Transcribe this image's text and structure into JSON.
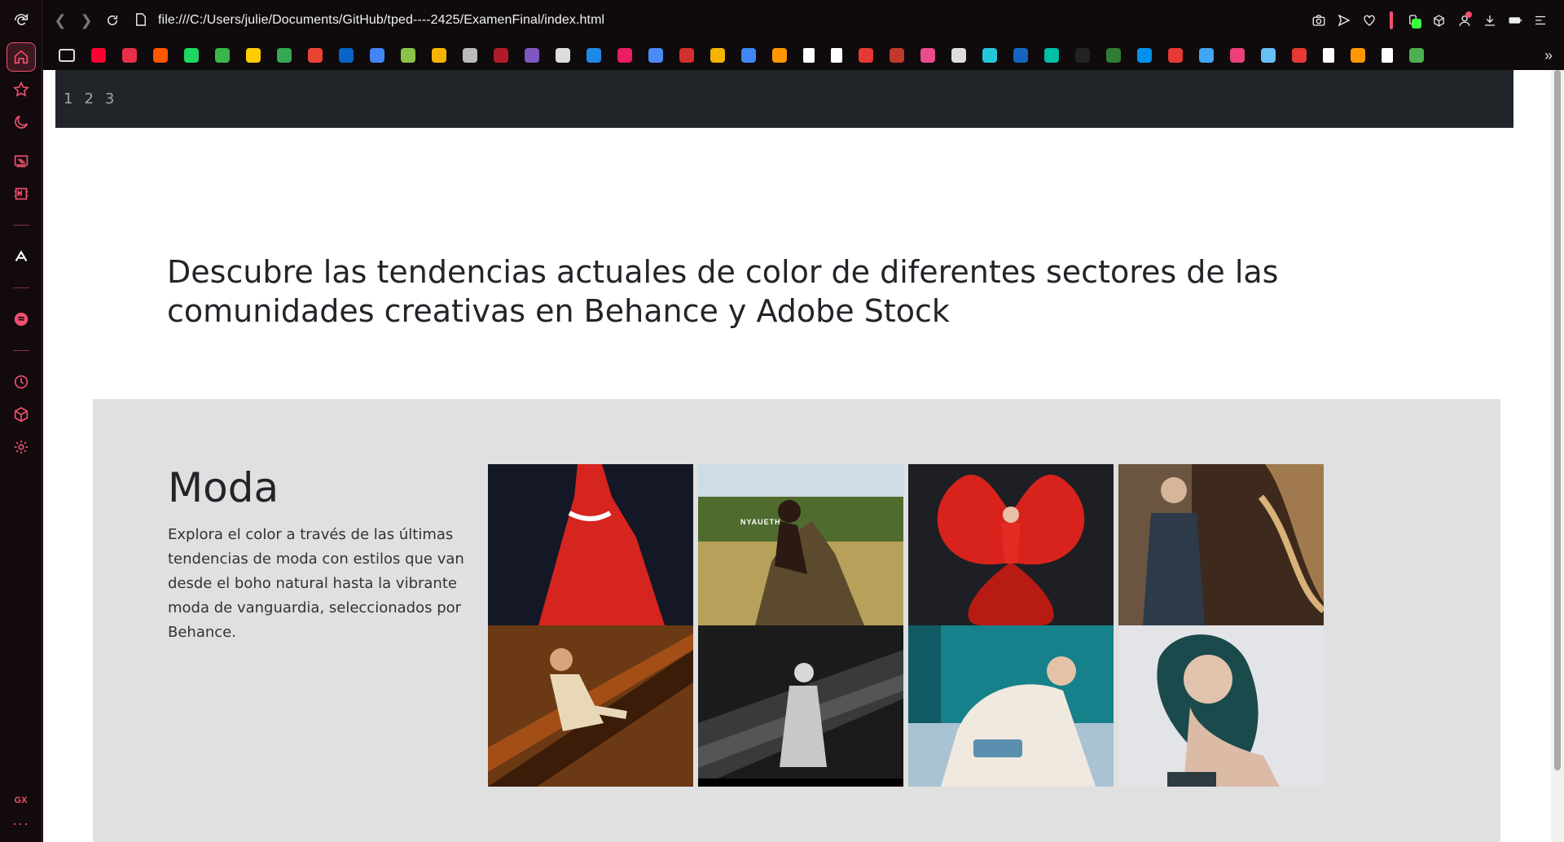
{
  "browser": {
    "url": "file:///C:/Users/julie/Documents/GitHub/tped----2425/ExamenFinal/index.html",
    "sidebar": {
      "gx_label": "GX",
      "more_label": "···"
    },
    "accent": "#f0506e"
  },
  "bookmarks": [
    {
      "name": "youtube",
      "color": "#ff0033"
    },
    {
      "name": "downloader",
      "color": "#e8304a"
    },
    {
      "name": "reddit",
      "color": "#ff5700"
    },
    {
      "name": "spotify",
      "color": "#1ed760"
    },
    {
      "name": "stats",
      "color": "#39b54a"
    },
    {
      "name": "dots",
      "color": "#ffcc00"
    },
    {
      "name": "drive",
      "color": "#34a853"
    },
    {
      "name": "gmail",
      "color": "#ea4335"
    },
    {
      "name": "outlook",
      "color": "#0a64c8"
    },
    {
      "name": "google",
      "color": "#4285f4"
    },
    {
      "name": "globe",
      "color": "#8bc34a"
    },
    {
      "name": "photos",
      "color": "#f4b400"
    },
    {
      "name": "note",
      "color": "#bbbbbb"
    },
    {
      "name": "ornament",
      "color": "#b21a2a"
    },
    {
      "name": "layers",
      "color": "#7e57c2"
    },
    {
      "name": "openai",
      "color": "#dddddd"
    },
    {
      "name": "meet",
      "color": "#1e88e5"
    },
    {
      "name": "s-app",
      "color": "#e91e63"
    },
    {
      "name": "translate",
      "color": "#4a8af4"
    },
    {
      "name": "readlist",
      "color": "#d32f2f"
    },
    {
      "name": "slides",
      "color": "#f4b400"
    },
    {
      "name": "docs",
      "color": "#4285f4"
    },
    {
      "name": "sheet-orange",
      "color": "#ff9800"
    },
    {
      "name": "page-1",
      "color": "#ffffff"
    },
    {
      "name": "page-2",
      "color": "#ffffff"
    },
    {
      "name": "ring",
      "color": "#e53935"
    },
    {
      "name": "figure",
      "color": "#c0392b"
    },
    {
      "name": "dribbble",
      "color": "#ea4c89"
    },
    {
      "name": "script-f",
      "color": "#dddddd"
    },
    {
      "name": "tag",
      "color": "#26c6da"
    },
    {
      "name": "ms",
      "color": "#1565c0"
    },
    {
      "name": "d-app",
      "color": "#00bfa5"
    },
    {
      "name": "play",
      "color": "#222222"
    },
    {
      "name": "px",
      "color": "#2e7d32"
    },
    {
      "name": "p-dot",
      "color": "#0091ea"
    },
    {
      "name": "stripes",
      "color": "#e53935"
    },
    {
      "name": "flag",
      "color": "#42a5f5"
    },
    {
      "name": "shield",
      "color": "#ec407a"
    },
    {
      "name": "steam",
      "color": "#66c0f4"
    },
    {
      "name": "bug",
      "color": "#e53935"
    },
    {
      "name": "w",
      "color": "#ffffff"
    },
    {
      "name": "a-app",
      "color": "#ff9800"
    },
    {
      "name": "page-3",
      "color": "#ffffff"
    },
    {
      "name": "g-app",
      "color": "#4caf50"
    }
  ],
  "page": {
    "nav_links": [
      "1",
      "2",
      "3"
    ],
    "headline": "Descubre las tendencias actuales de color de diferentes sectores de las comunidades creativas en Behance y Adobe Stock",
    "section": {
      "title": "Moda",
      "description": "Explora el color a través de las últimas tendencias de moda con estilos que van desde el boho natural hasta la vibrante moda de vanguardia, seleccionados por Behance.",
      "photos": [
        {
          "name": "red-gown-photo",
          "bg": "#141826",
          "accent": "#d6241e"
        },
        {
          "name": "savanna-portrait-photo",
          "bg": "#8ea56a",
          "accent": "#2a1a12",
          "caption": "NYAUETH"
        },
        {
          "name": "red-flower-photo",
          "bg": "#1e1f24",
          "accent": "#d8231c"
        },
        {
          "name": "blue-suit-photo",
          "bg": "#3e2a1c",
          "accent": "#2c3a4a"
        },
        {
          "name": "amber-staircase-photo",
          "bg": "#6b3a14",
          "accent": "#e9d8b8"
        },
        {
          "name": "monochrome-photo",
          "bg": "#1b1b1b",
          "accent": "#c8c8c8"
        },
        {
          "name": "teal-sofa-photo",
          "bg": "#0f5a63",
          "accent": "#efe9df"
        },
        {
          "name": "teal-hair-photo",
          "bg": "#e3e4e8",
          "accent": "#1b4a4c"
        }
      ]
    }
  }
}
